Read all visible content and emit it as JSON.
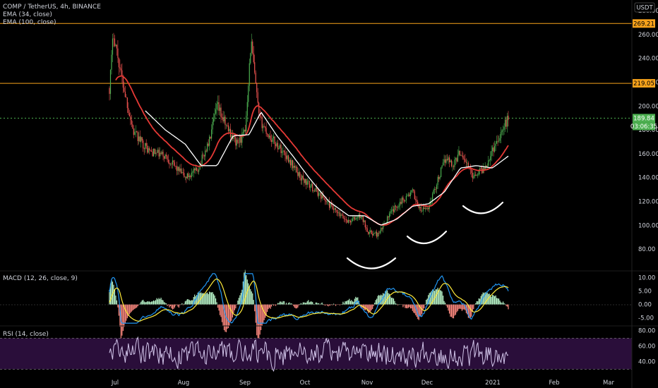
{
  "header": {
    "symbol": "COMP / TetherUS, 4h, BINANCE",
    "ind1": "EMA (34, close)",
    "ind2": "EMA (100, close)",
    "currency": "USDT",
    "macd_label": "MACD (12, 26, close, 9)",
    "rsi_label": "RSI (14, close)"
  },
  "colors": {
    "bg": "#000000",
    "up": "#26a69a",
    "candle_up": "#4caf50",
    "candle_down": "#ef5350",
    "ema34": "#e53935",
    "ema100": "#ffffff",
    "hline": "#f7a21b",
    "price_line": "#4caf50",
    "macd": "#2196f3",
    "signal": "#ffeb3b",
    "rsi": "#d1c4e9",
    "rsi_band": "#2a0e3a"
  },
  "chart_data": [
    {
      "type": "candlestick",
      "title": "COMP / TetherUS, 4h, BINANCE",
      "x_ticks": [
        "Jul",
        "Aug",
        "Sep",
        "Oct",
        "Nov",
        "Dec",
        "2021",
        "Feb",
        "Mar"
      ],
      "y_ticks": [
        "280.00",
        "260.00",
        "240.00",
        "220.00",
        "200.00",
        "180.00",
        "160.00",
        "140.00",
        "120.00",
        "100.00",
        "80.00"
      ],
      "ylim": [
        70,
        283
      ],
      "horizontal_levels": [
        {
          "value": 269.21,
          "label": "269.21"
        },
        {
          "value": 219.05,
          "label": "219.05"
        }
      ],
      "last_price": {
        "value": 189.84,
        "label": "189.84",
        "countdown": "03:06:35"
      },
      "close_path": [
        {
          "t": 0.0,
          "v": 215
        },
        {
          "t": 0.01,
          "v": 262
        },
        {
          "t": 0.03,
          "v": 225
        },
        {
          "t": 0.06,
          "v": 178
        },
        {
          "t": 0.1,
          "v": 162
        },
        {
          "t": 0.14,
          "v": 158
        },
        {
          "t": 0.19,
          "v": 140
        },
        {
          "t": 0.22,
          "v": 146
        },
        {
          "t": 0.25,
          "v": 170
        },
        {
          "t": 0.27,
          "v": 200
        },
        {
          "t": 0.29,
          "v": 185
        },
        {
          "t": 0.32,
          "v": 168
        },
        {
          "t": 0.34,
          "v": 178
        },
        {
          "t": 0.355,
          "v": 255
        },
        {
          "t": 0.375,
          "v": 190
        },
        {
          "t": 0.4,
          "v": 175
        },
        {
          "t": 0.44,
          "v": 160
        },
        {
          "t": 0.48,
          "v": 140
        },
        {
          "t": 0.53,
          "v": 125
        },
        {
          "t": 0.57,
          "v": 110
        },
        {
          "t": 0.6,
          "v": 103
        },
        {
          "t": 0.63,
          "v": 108
        },
        {
          "t": 0.65,
          "v": 94
        },
        {
          "t": 0.675,
          "v": 92
        },
        {
          "t": 0.7,
          "v": 108
        },
        {
          "t": 0.73,
          "v": 120
        },
        {
          "t": 0.76,
          "v": 128
        },
        {
          "t": 0.78,
          "v": 112
        },
        {
          "t": 0.8,
          "v": 115
        },
        {
          "t": 0.82,
          "v": 135
        },
        {
          "t": 0.845,
          "v": 158
        },
        {
          "t": 0.86,
          "v": 150
        },
        {
          "t": 0.88,
          "v": 162
        },
        {
          "t": 0.91,
          "v": 142
        },
        {
          "t": 0.94,
          "v": 148
        },
        {
          "t": 0.97,
          "v": 170
        },
        {
          "t": 1.0,
          "v": 189.84
        }
      ],
      "ema100_path": [
        {
          "t": 0.09,
          "v": 196
        },
        {
          "t": 0.14,
          "v": 180
        },
        {
          "t": 0.19,
          "v": 168
        },
        {
          "t": 0.23,
          "v": 150
        },
        {
          "t": 0.27,
          "v": 150
        },
        {
          "t": 0.31,
          "v": 175
        },
        {
          "t": 0.35,
          "v": 176
        },
        {
          "t": 0.38,
          "v": 195
        },
        {
          "t": 0.42,
          "v": 175
        },
        {
          "t": 0.46,
          "v": 158
        },
        {
          "t": 0.5,
          "v": 140
        },
        {
          "t": 0.55,
          "v": 120
        },
        {
          "t": 0.6,
          "v": 108
        },
        {
          "t": 0.64,
          "v": 108
        },
        {
          "t": 0.68,
          "v": 100
        },
        {
          "t": 0.72,
          "v": 105
        },
        {
          "t": 0.76,
          "v": 116
        },
        {
          "t": 0.8,
          "v": 118
        },
        {
          "t": 0.84,
          "v": 128
        },
        {
          "t": 0.88,
          "v": 148
        },
        {
          "t": 0.92,
          "v": 150
        },
        {
          "t": 0.96,
          "v": 148
        },
        {
          "t": 1.0,
          "v": 158
        }
      ],
      "annotations": [
        "hand-drawn-arcs"
      ]
    },
    {
      "type": "bar",
      "title": "MACD (12, 26, close, 9)",
      "y_ticks": [
        "10.00",
        "5.00",
        "0.00",
        "-5.00"
      ],
      "ylim": [
        -7.5,
        12
      ]
    },
    {
      "type": "line",
      "title": "RSI (14, close)",
      "y_ticks": [
        "80.00",
        "60.00",
        "40.00"
      ],
      "ylim": [
        24,
        84
      ],
      "band": [
        30,
        70
      ]
    }
  ]
}
